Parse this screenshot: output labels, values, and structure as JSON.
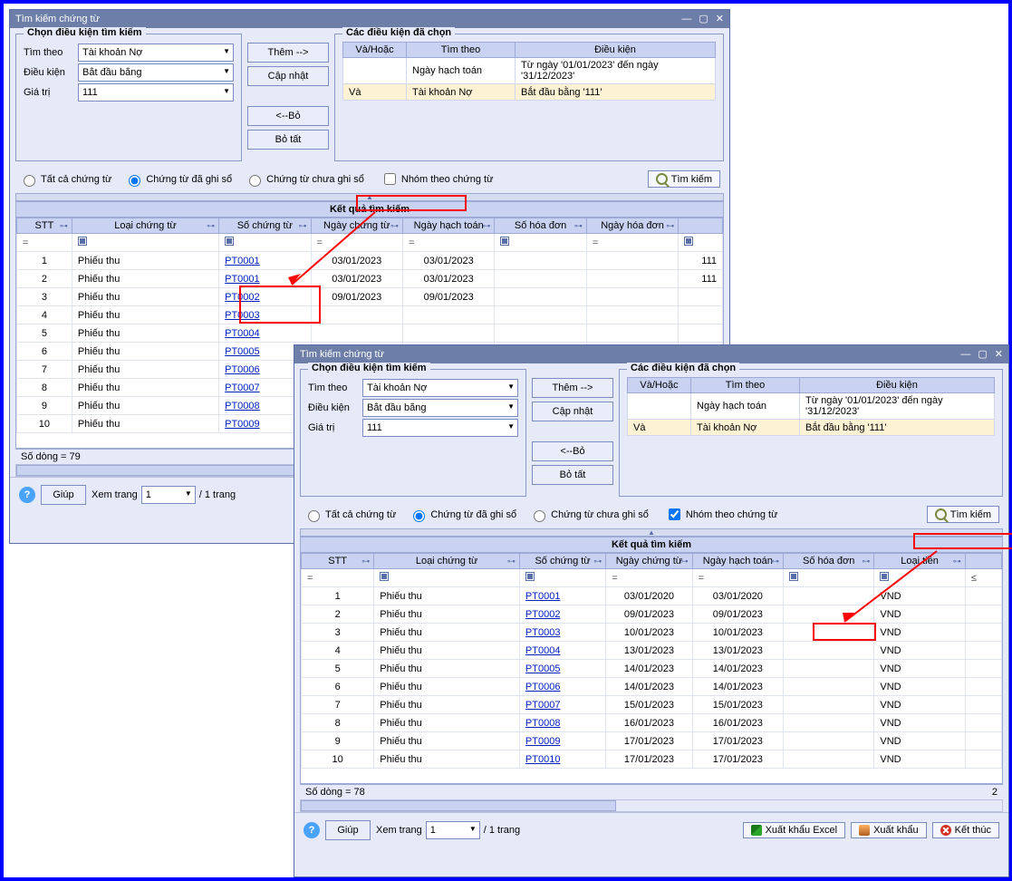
{
  "win1": {
    "title": "Tìm kiếm chứng từ",
    "cond_legend": "Chọn điều kiện tìm kiếm",
    "sel_legend": "Các điều kiện đã chọn",
    "lbl_timtheo": "Tìm theo",
    "lbl_dieukien": "Điều kiện",
    "lbl_giatri": "Giá trị",
    "val_timtheo": "Tài khoản Nợ",
    "val_dieukien": "Bắt đầu bằng",
    "val_giatri": "111",
    "btn_them": "Thêm  -->",
    "btn_capnhat": "Cập nhật",
    "btn_bo": "<--Bỏ",
    "btn_botat": "Bỏ tất",
    "cond_headers": [
      "Và/Hoặc",
      "Tìm theo",
      "Điều kiện"
    ],
    "cond_rows": [
      {
        "vh": "",
        "tt": "Ngày hạch toán",
        "dk": "Từ ngày '01/01/2023' đến ngày '31/12/2023'"
      },
      {
        "vh": "Và",
        "tt": "Tài khoản Nợ",
        "dk": "Bắt đầu bằng '111'",
        "sel": true
      }
    ],
    "radio_all": "Tất cả chứng từ",
    "radio_ghiso": "Chứng từ đã ghi sổ",
    "radio_chua": "Chứng từ chưa ghi sổ",
    "chk_nhom": "Nhóm theo chứng từ",
    "btn_timkiem": "Tìm kiếm",
    "results_title": "Kết quả tìm kiếm",
    "grid_headers": [
      "STT",
      "Loại chứng từ",
      "Số chứng từ",
      "Ngày chứng từ",
      "Ngày hạch toán",
      "Số hóa đơn",
      "Ngày hóa đơn"
    ],
    "grid_rows": [
      {
        "stt": "1",
        "loai": "Phiếu thu",
        "so": "PT0001",
        "nct": "03/01/2023",
        "nht": "03/01/2023",
        "shd": "",
        "nhd": "",
        "tail": "111"
      },
      {
        "stt": "2",
        "loai": "Phiếu thu",
        "so": "PT0001",
        "nct": "03/01/2023",
        "nht": "03/01/2023",
        "shd": "",
        "nhd": "",
        "tail": "111"
      },
      {
        "stt": "3",
        "loai": "Phiếu thu",
        "so": "PT0002",
        "nct": "09/01/2023",
        "nht": "09/01/2023",
        "shd": "",
        "nhd": "",
        "tail": ""
      },
      {
        "stt": "4",
        "loai": "Phiếu thu",
        "so": "PT0003",
        "nct": "",
        "nht": "",
        "shd": "",
        "nhd": "",
        "tail": ""
      },
      {
        "stt": "5",
        "loai": "Phiếu thu",
        "so": "PT0004",
        "nct": "",
        "nht": "",
        "shd": "",
        "nhd": "",
        "tail": ""
      },
      {
        "stt": "6",
        "loai": "Phiếu thu",
        "so": "PT0005",
        "nct": "",
        "nht": "",
        "shd": "",
        "nhd": "",
        "tail": ""
      },
      {
        "stt": "7",
        "loai": "Phiếu thu",
        "so": "PT0006",
        "nct": "",
        "nht": "",
        "shd": "",
        "nhd": "",
        "tail": ""
      },
      {
        "stt": "8",
        "loai": "Phiếu thu",
        "so": "PT0007",
        "nct": "",
        "nht": "",
        "shd": "",
        "nhd": "",
        "tail": ""
      },
      {
        "stt": "9",
        "loai": "Phiếu thu",
        "so": "PT0008",
        "nct": "",
        "nht": "",
        "shd": "",
        "nhd": "",
        "tail": ""
      },
      {
        "stt": "10",
        "loai": "Phiếu thu",
        "so": "PT0009",
        "nct": "",
        "nht": "",
        "shd": "",
        "nhd": "",
        "tail": ""
      }
    ],
    "rowcount": "Số dòng = 79",
    "help": "Giúp",
    "page_lbl": "Xem trang",
    "page_val": "1",
    "page_suffix": "/ 1 trang"
  },
  "win2": {
    "title": "Tìm kiếm chứng từ",
    "results_title": "Kết quả tìm kiếm",
    "grid_headers": [
      "STT",
      "Loại chứng từ",
      "Số chứng từ",
      "Ngày chứng từ",
      "Ngày hạch toán",
      "Số hóa đơn",
      "Loại tiền"
    ],
    "grid_rows": [
      {
        "stt": "1",
        "loai": "Phiếu thu",
        "so": "PT0001",
        "nct": "03/01/2020",
        "nht": "03/01/2020",
        "shd": "",
        "lt": "VND"
      },
      {
        "stt": "2",
        "loai": "Phiếu thu",
        "so": "PT0002",
        "nct": "09/01/2023",
        "nht": "09/01/2023",
        "shd": "",
        "lt": "VND"
      },
      {
        "stt": "3",
        "loai": "Phiếu thu",
        "so": "PT0003",
        "nct": "10/01/2023",
        "nht": "10/01/2023",
        "shd": "",
        "lt": "VND"
      },
      {
        "stt": "4",
        "loai": "Phiếu thu",
        "so": "PT0004",
        "nct": "13/01/2023",
        "nht": "13/01/2023",
        "shd": "",
        "lt": "VND"
      },
      {
        "stt": "5",
        "loai": "Phiếu thu",
        "so": "PT0005",
        "nct": "14/01/2023",
        "nht": "14/01/2023",
        "shd": "",
        "lt": "VND"
      },
      {
        "stt": "6",
        "loai": "Phiếu thu",
        "so": "PT0006",
        "nct": "14/01/2023",
        "nht": "14/01/2023",
        "shd": "",
        "lt": "VND"
      },
      {
        "stt": "7",
        "loai": "Phiếu thu",
        "so": "PT0007",
        "nct": "15/01/2023",
        "nht": "15/01/2023",
        "shd": "",
        "lt": "VND"
      },
      {
        "stt": "8",
        "loai": "Phiếu thu",
        "so": "PT0008",
        "nct": "16/01/2023",
        "nht": "16/01/2023",
        "shd": "",
        "lt": "VND"
      },
      {
        "stt": "9",
        "loai": "Phiếu thu",
        "so": "PT0009",
        "nct": "17/01/2023",
        "nht": "17/01/2023",
        "shd": "",
        "lt": "VND"
      },
      {
        "stt": "10",
        "loai": "Phiếu thu",
        "so": "PT0010",
        "nct": "17/01/2023",
        "nht": "17/01/2023",
        "shd": "",
        "lt": "VND"
      }
    ],
    "rowcount": "Số dòng = 78",
    "sum_corner": "2",
    "help": "Giúp",
    "page_lbl": "Xem trang",
    "page_val": "1",
    "page_suffix": "/ 1 trang",
    "btn_excel": "Xuất khẩu Excel",
    "btn_export": "Xuất khẩu",
    "btn_close": "Kết thúc"
  }
}
